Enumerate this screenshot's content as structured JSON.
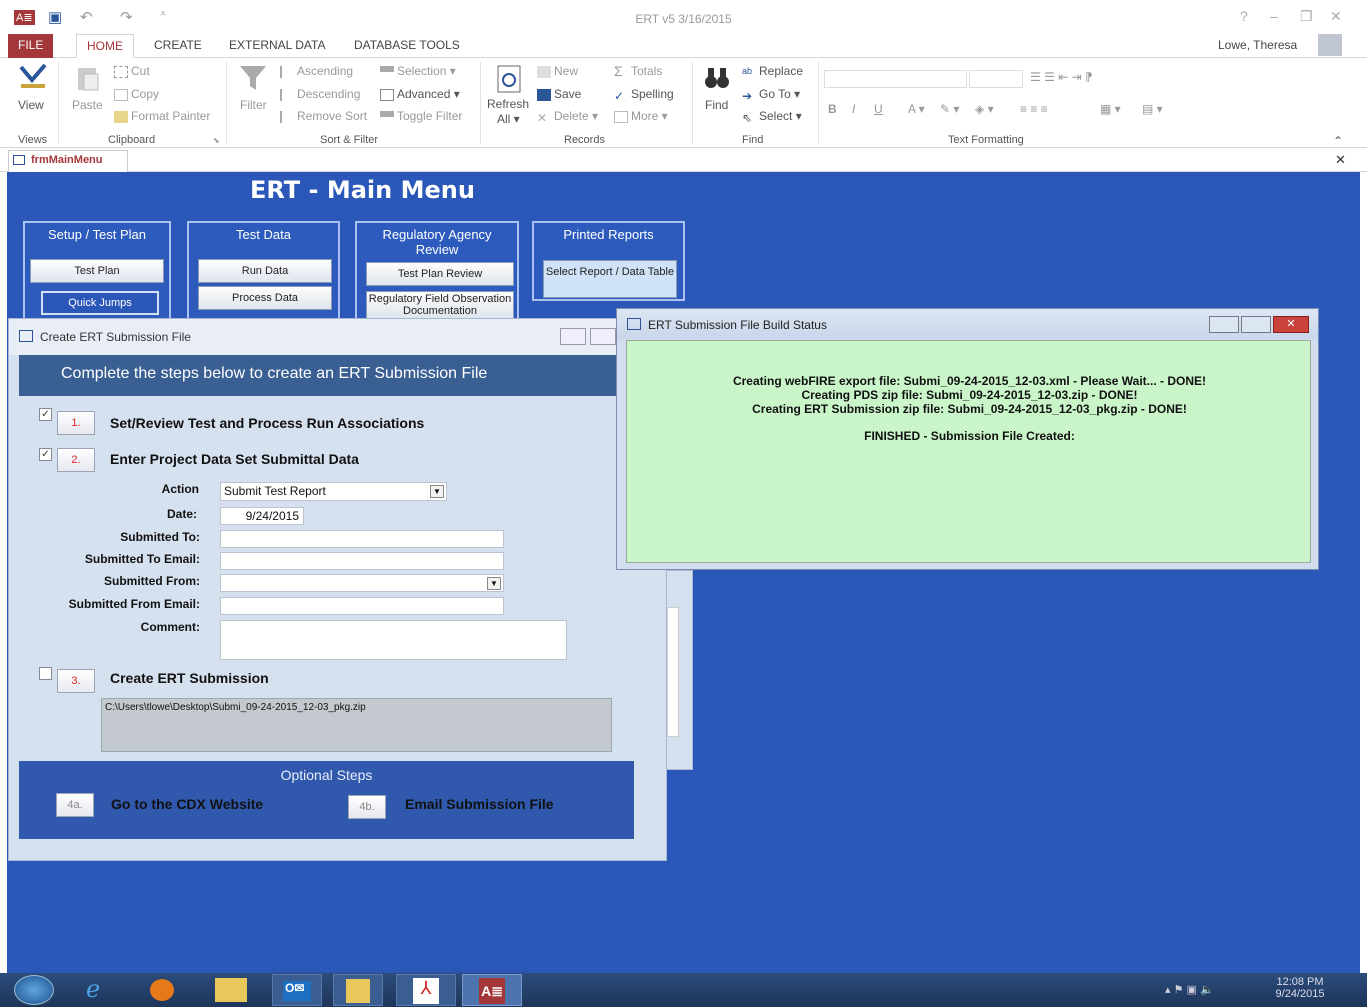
{
  "titlebar": {
    "title": "ERT v5 3/16/2015",
    "help": "?",
    "minimize": "–",
    "restore": "❐",
    "close": "✕"
  },
  "tabs": {
    "file": "FILE",
    "home": "HOME",
    "create": "CREATE",
    "external": "EXTERNAL DATA",
    "dbtools": "DATABASE TOOLS",
    "user": "Lowe, Theresa"
  },
  "ribbon": {
    "view": "View",
    "paste": "Paste",
    "cut": "Cut",
    "copy": "Copy",
    "format_painter": "Format Painter",
    "filter": "Filter",
    "ascending": "Ascending",
    "descending": "Descending",
    "remove_sort": "Remove Sort",
    "selection": "Selection",
    "advanced": "Advanced",
    "toggle_filter": "Toggle Filter",
    "refresh": "Refresh",
    "refresh_all": "All",
    "new": "New",
    "save": "Save",
    "delete": "Delete",
    "totals": "Totals",
    "spelling": "Spelling",
    "more": "More",
    "find": "Find",
    "replace": "Replace",
    "goto": "Go To",
    "select": "Select",
    "groups": {
      "views": "Views",
      "clipboard": "Clipboard",
      "sort_filter": "Sort & Filter",
      "records": "Records",
      "find": "Find",
      "text_formatting": "Text Formatting"
    }
  },
  "doctab": {
    "label": "frmMainMenu"
  },
  "main": {
    "title": "ERT - Main Menu",
    "panels": [
      {
        "header": "Setup / Test Plan",
        "buttons": [
          "Test Plan",
          "Quick Jumps"
        ]
      },
      {
        "header": "Test Data",
        "buttons": [
          "Run Data",
          "Process Data"
        ]
      },
      {
        "header": "Regulatory Agency Review",
        "buttons": [
          "Test Plan Review",
          "Regulatory Field Observation Documentation"
        ]
      },
      {
        "header": "Printed Reports",
        "buttons": [
          "Select Report / Data Table"
        ]
      }
    ]
  },
  "dialog": {
    "title": "Create ERT Submission File",
    "header": "Complete the steps below to create an ERT Submission File",
    "step1": {
      "num": "1.",
      "label": "Set/Review Test and Process Run Associations",
      "checked": true
    },
    "step2": {
      "num": "2.",
      "label": "Enter Project Data Set Submittal Data",
      "checked": true
    },
    "fields": {
      "action_label": "Action",
      "action_value": "Submit Test Report",
      "date_label": "Date:",
      "date_value": "9/24/2015",
      "to_label": "Submitted To:",
      "to_email_label": "Submitted To Email:",
      "from_label": "Submitted From:",
      "from_email_label": "Submitted From Email:",
      "comment_label": "Comment:"
    },
    "step3": {
      "num": "3.",
      "label": "Create ERT Submission",
      "checked": false,
      "path": "C:\\Users\\tlowe\\Desktop\\Submi_09-24-2015_12-03_pkg.zip"
    },
    "optional": {
      "header": "Optional Steps",
      "a_num": "4a.",
      "a_label": "Go to the CDX Website",
      "b_num": "4b.",
      "b_label": "Email Submission File"
    }
  },
  "status": {
    "title": "ERT Submission File Build Status",
    "lines": [
      "Creating webFIRE export file: Submi_09-24-2015_12-03.xml - Please Wait... - DONE!",
      "Creating PDS zip file: Submi_09-24-2015_12-03.zip - DONE!",
      "Creating ERT Submission zip file: Submi_09-24-2015_12-03_pkg.zip - DONE!",
      "FINISHED - Submission File Created:"
    ]
  },
  "taskbar": {
    "time": "12:08 PM",
    "date": "9/24/2015"
  }
}
